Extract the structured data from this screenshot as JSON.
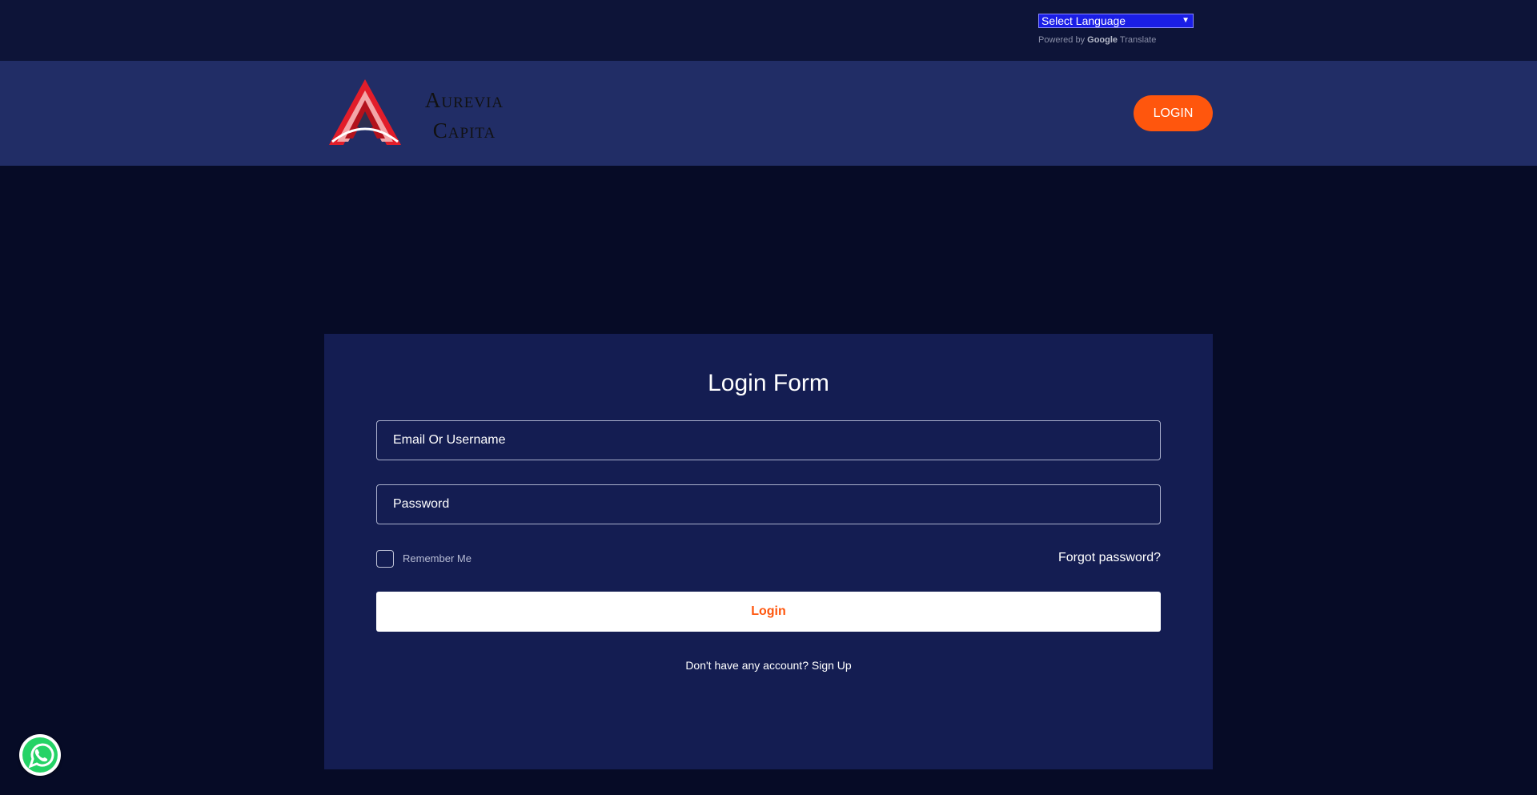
{
  "translate": {
    "select_label": "Select Language",
    "powered_by": "Powered by",
    "google": "Google",
    "translate_word": "Translate"
  },
  "header": {
    "brand_line1": "Aurevia",
    "brand_line2": "Capita",
    "login_button": "LOGIN"
  },
  "form": {
    "title": "Login Form",
    "email_placeholder": "Email Or Username",
    "password_placeholder": "Password",
    "remember_label": "Remember Me",
    "forgot_link": "Forgot password?",
    "submit_label": "Login",
    "signup_prompt": "Don't have any account? Sign Up"
  },
  "colors": {
    "accent": "#ff560d",
    "header_bg": "#212d66",
    "page_bg": "#060b26",
    "card_bg": "#141d52"
  },
  "icons": {
    "logo": "triangle-a-logo-icon",
    "whatsapp": "whatsapp-icon",
    "dropdown": "chevron-down-icon"
  }
}
